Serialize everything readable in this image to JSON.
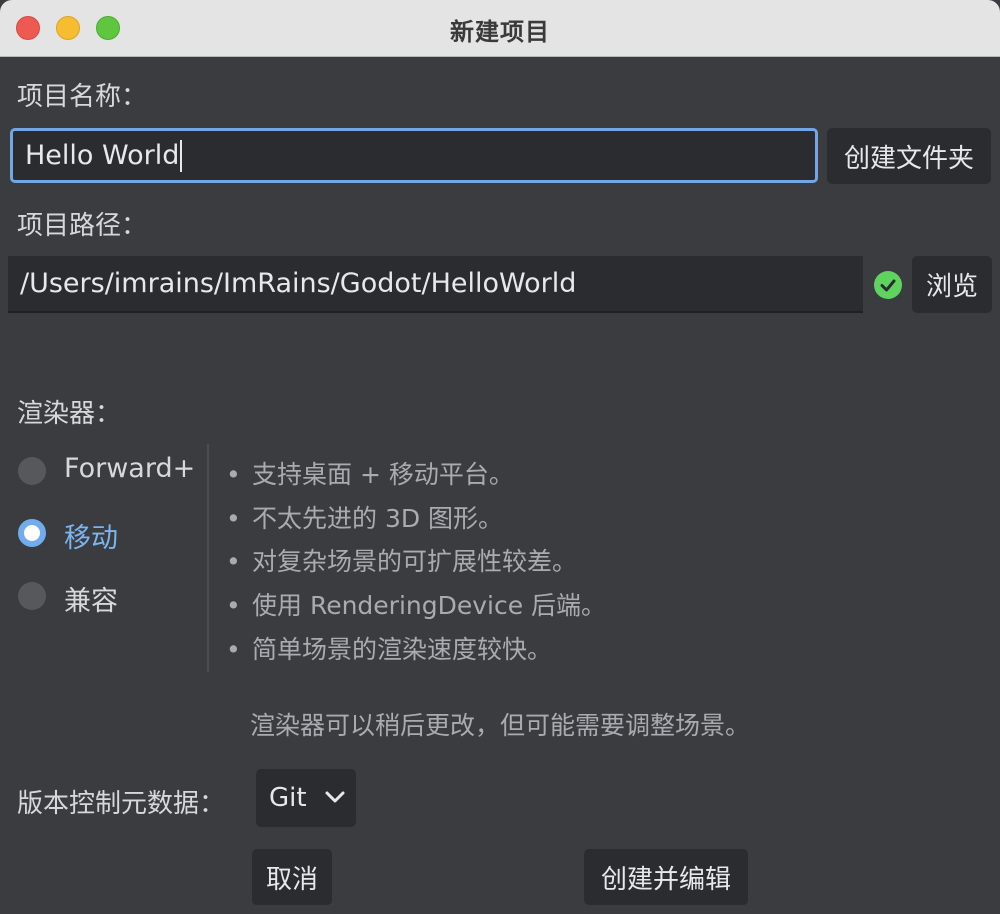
{
  "window": {
    "title": "新建项目"
  },
  "project_name": {
    "label": "项目名称：",
    "value": "Hello World",
    "create_folder_label": "创建文件夹"
  },
  "project_path": {
    "label": "项目路径：",
    "value": "/Users/imrains/ImRains/Godot/HelloWorld",
    "browse_label": "浏览",
    "status_icon": "check-circle-icon",
    "status_color": "#5ed35e"
  },
  "renderer": {
    "label": "渲染器：",
    "options": [
      {
        "label": "Forward+",
        "selected": false
      },
      {
        "label": "移动",
        "selected": true
      },
      {
        "label": "兼容",
        "selected": false
      }
    ],
    "description": [
      "支持桌面 + 移动平台。",
      "不太先进的 3D 图形。",
      "对复杂场景的可扩展性较差。",
      "使用 RenderingDevice 后端。",
      "简单场景的渲染速度较快。"
    ],
    "note": "渲染器可以稍后更改，但可能需要调整场景。"
  },
  "vcs": {
    "label": "版本控制元数据：",
    "selected": "Git"
  },
  "actions": {
    "cancel_label": "取消",
    "create_edit_label": "创建并编辑"
  },
  "colors": {
    "accent": "#73a6e4",
    "background": "#3a3c40",
    "field": "#2a2c30"
  }
}
